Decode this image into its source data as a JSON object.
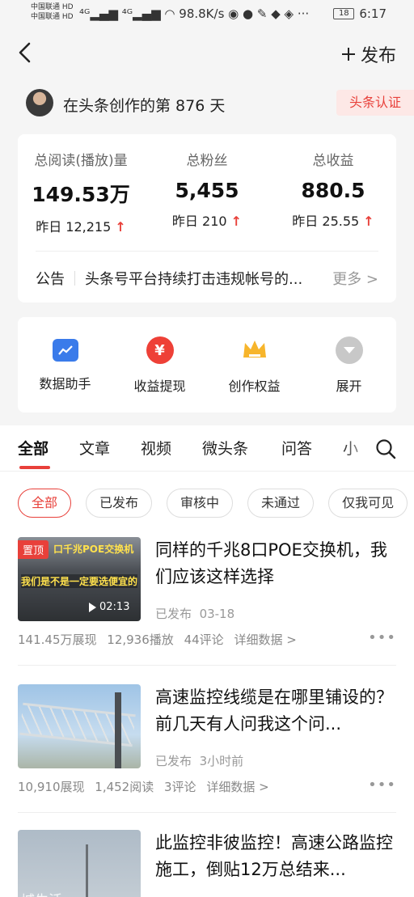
{
  "status_bar": {
    "carrier1": "中国联通 HD",
    "carrier2": "中国联通 HD",
    "net_speed": "98.8K/s",
    "battery": "18",
    "time": "6:17"
  },
  "header": {
    "publish_label": "发布"
  },
  "creator": {
    "days_text": "在头条创作的第 876 天",
    "verify_label": "头条认证"
  },
  "stats": [
    {
      "label": "总阅读(播放)量",
      "value": "149.53万",
      "delta": "昨日 12,215"
    },
    {
      "label": "总粉丝",
      "value": "5,455",
      "delta": "昨日 210"
    },
    {
      "label": "总收益",
      "value": "880.5",
      "delta": "昨日 25.55"
    }
  ],
  "notice": {
    "label": "公告",
    "text": "头条号平台持续打击违规帐号的...",
    "more": "更多 >"
  },
  "tools": [
    {
      "label": "数据助手",
      "icon": "chart-icon",
      "color": "#3a7bea"
    },
    {
      "label": "收益提现",
      "icon": "yuan-icon",
      "color": "#ee4037",
      "glyph": "¥"
    },
    {
      "label": "创作权益",
      "icon": "crown-icon",
      "color": "#f7b52b"
    },
    {
      "label": "展开",
      "icon": "expand-icon",
      "color": "#c8c8c8"
    }
  ],
  "tabs": [
    "全部",
    "文章",
    "视频",
    "微头条",
    "问答",
    "小"
  ],
  "filters": [
    "全部",
    "已发布",
    "审核中",
    "未通过",
    "仅我可见"
  ],
  "articles": [
    {
      "pinned": "置顶",
      "thumb_caption1": "口千兆POE交换机",
      "thumb_caption2": "我们是不是一定要选便宜的",
      "duration": "02:13",
      "title": "同样的千兆8口POE交换机，我们应该这样选择",
      "status": "已发布",
      "time": "03-18",
      "impressions": "141.45万展现",
      "plays": "12,936播放",
      "comments": "44评论",
      "detail": "详细数据 >"
    },
    {
      "title": "高速监控线缆是在哪里铺设的？前几天有人问我这个问...",
      "status": "已发布",
      "time": "3小时前",
      "impressions": "10,910展现",
      "plays": "1,452阅读",
      "comments": "3评论",
      "detail": "详细数据 >"
    },
    {
      "watermark": "城生活",
      "title": "此监控非彼监控！高速公路监控施工，倒贴12万总结来..."
    }
  ]
}
